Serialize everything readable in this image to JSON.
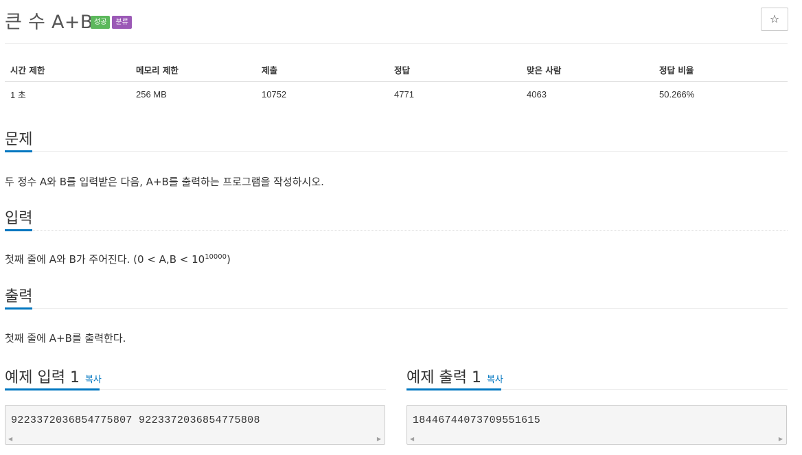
{
  "problem": {
    "title": "큰 수 A+B",
    "badges": {
      "success": "성공",
      "category": "분류"
    },
    "star_icon": "☆"
  },
  "info_table": {
    "headers": [
      "시간 제한",
      "메모리 제한",
      "제출",
      "정답",
      "맞은 사람",
      "정답 비율"
    ],
    "values": [
      "1 초",
      "256 MB",
      "10752",
      "4771",
      "4063",
      "50.266%"
    ]
  },
  "sections": {
    "description": {
      "heading": "문제",
      "text": "두 정수 A와 B를 입력받은 다음, A+B를 출력하는 프로그램을 작성하시오."
    },
    "input": {
      "heading": "입력",
      "text_before": "첫째 줄에 A와 B가 주어진다. (0 < A,B < 10",
      "sup": "10000",
      "text_after": ")"
    },
    "output": {
      "heading": "출력",
      "text": "첫째 줄에 A+B를 출력한다."
    }
  },
  "samples": {
    "input": {
      "heading": "예제 입력 1",
      "copy_label": "복사",
      "content": "9223372036854775807 9223372036854775808"
    },
    "output": {
      "heading": "예제 출력 1",
      "copy_label": "복사",
      "content": "18446744073709551615"
    }
  },
  "colors": {
    "accent": "#0076c0",
    "badge_success": "#5cb85c",
    "badge_category": "#9b59b6"
  },
  "icons": {
    "star": "star-icon",
    "scroll_left": "chevron-left-icon",
    "scroll_right": "chevron-right-icon"
  }
}
